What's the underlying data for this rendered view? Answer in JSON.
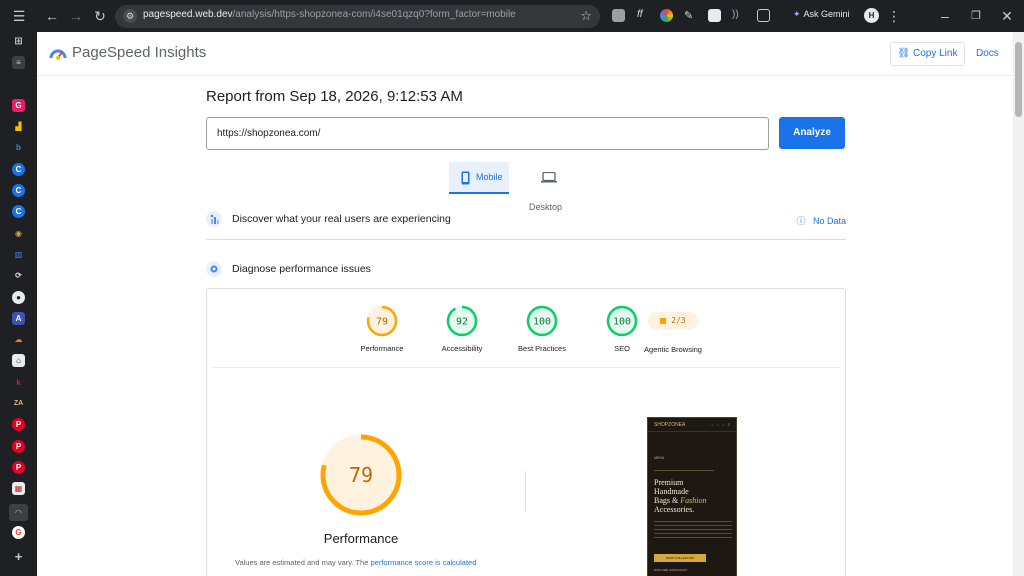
{
  "browser": {
    "url_host": "pagespeed.web.dev",
    "url_rest": "/analysis/https-shopzonea-com/i4se01qzq0?form_factor=mobile",
    "ask_gemini": "Ask Gemini"
  },
  "header": {
    "title": "PageSpeed Insights",
    "copy_link": "Copy Link",
    "docs": "Docs"
  },
  "report": {
    "title": "Report from Sep 18, 2026, 9:12:53 AM",
    "url_value": "https://shopzonea.com/",
    "analyze": "Analyze"
  },
  "tabs": {
    "mobile": "Mobile",
    "desktop": "Desktop"
  },
  "discover": {
    "title": "Discover what your real users are experiencing",
    "status": "No Data"
  },
  "diagnose": {
    "title": "Diagnose performance issues"
  },
  "scores": [
    {
      "label": "Performance",
      "value": "79",
      "fraction": 0.79,
      "color": "#ffa400",
      "bg": "#fff3e0",
      "text": "#c26401"
    },
    {
      "label": "Accessibility",
      "value": "92",
      "fraction": 0.92,
      "color": "#0cce6b",
      "bg": "#e6f9ee",
      "text": "#0d7a3c"
    },
    {
      "label": "Best Practices",
      "value": "100",
      "fraction": 1.0,
      "color": "#0cce6b",
      "bg": "#e6f9ee",
      "text": "#0d7a3c"
    },
    {
      "label": "SEO",
      "value": "100",
      "fraction": 1.0,
      "color": "#0cce6b",
      "bg": "#e6f9ee",
      "text": "#0d7a3c"
    }
  ],
  "agentic": {
    "label": "Agentic Browsing",
    "value": "2/3"
  },
  "performance_big": {
    "value": "79",
    "fraction": 0.79,
    "label": "Performance",
    "note_prefix": "Values are estimated and may vary. The ",
    "note_link": "performance score is calculated"
  },
  "preview": {
    "logo": "SHOPZONEA",
    "menu": "MENU",
    "heading_1": "Premium",
    "heading_2": "Handmade",
    "heading_3a": "Bags & ",
    "heading_3b": "Fashion",
    "heading_4": "Accessories.",
    "button": "SHOP COLLECTION",
    "footer": "EXPLORE HANDCRAFT"
  }
}
